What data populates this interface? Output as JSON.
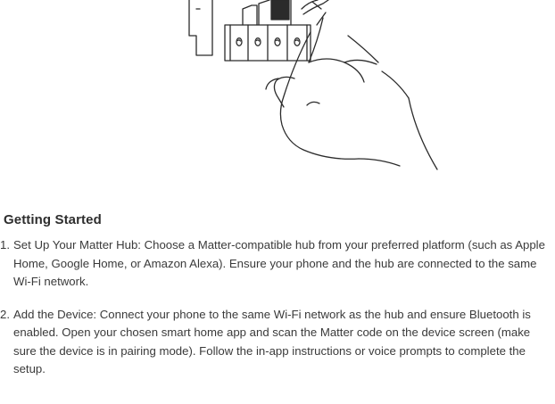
{
  "section": {
    "title": "Getting Started"
  },
  "illustration": {
    "icon": "hand-pressing-device-icon"
  },
  "steps": [
    {
      "number": "1.",
      "text": "Set Up Your Matter Hub: Choose a Matter-compatible hub from your preferred platform (such as Apple Home, Google Home, or Amazon Alexa). Ensure your phone and the hub are connected to the same Wi-Fi network."
    },
    {
      "number": "2.",
      "text": "Add the Device: Connect your phone to the same Wi-Fi network as the hub and ensure Bluetooth is enabled. Open your chosen smart home app and scan the Matter code on the device screen (make sure the device is in pairing mode). Follow the in-app instructions or voice prompts to complete the setup."
    }
  ]
}
